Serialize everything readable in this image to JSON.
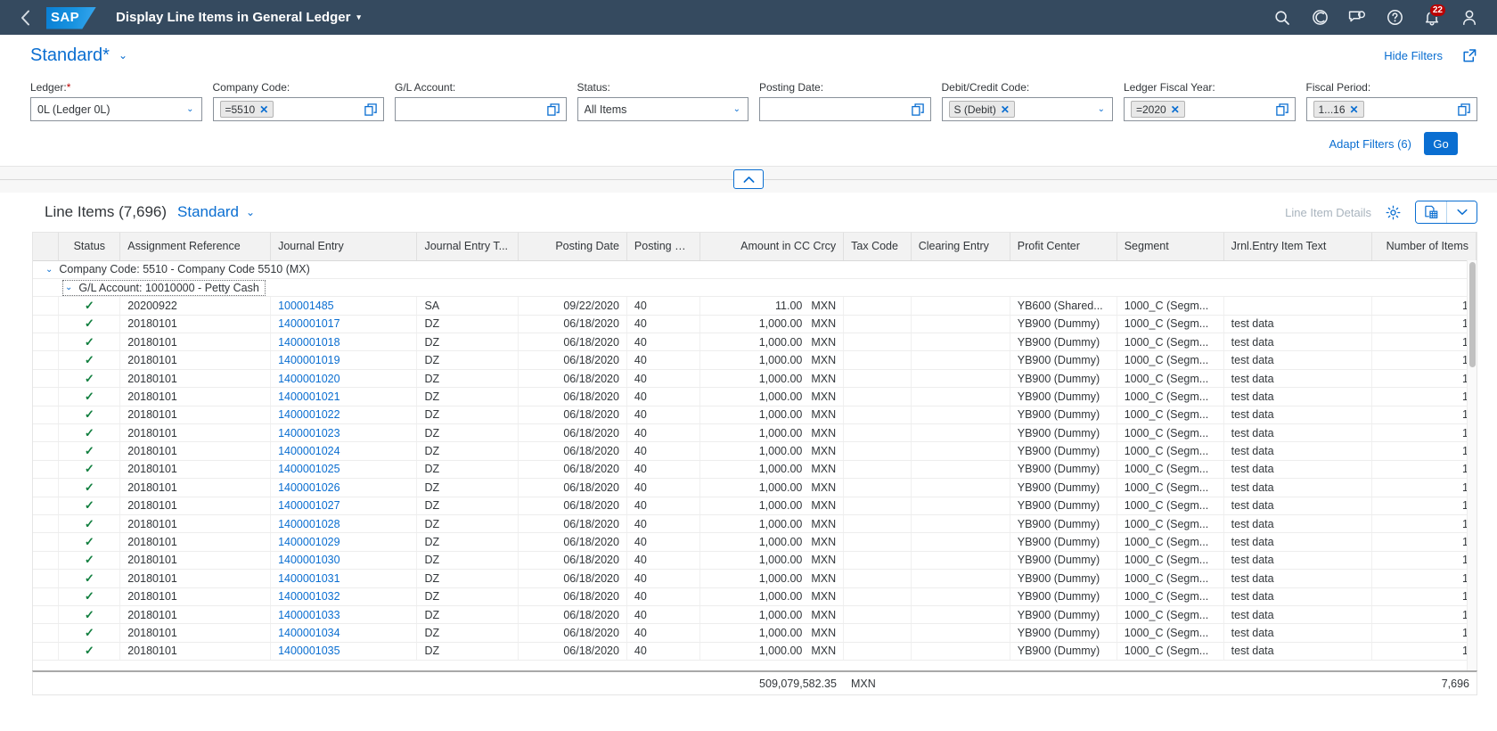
{
  "shell": {
    "back_icon": "navigate-back-icon",
    "logo_text": "SAP",
    "app_title": "Display Line Items in General Ledger",
    "title_caret": "▾",
    "icons": [
      {
        "name": "search-icon"
      },
      {
        "name": "copilot-icon"
      },
      {
        "name": "notes-icon"
      },
      {
        "name": "help-icon"
      },
      {
        "name": "notifications-icon",
        "badge": "22"
      },
      {
        "name": "user-avatar-icon"
      }
    ]
  },
  "variant": {
    "title": "Standard*",
    "caret": "⌄",
    "hide_filters": "Hide Filters",
    "share_icon": "share-icon"
  },
  "filters": [
    {
      "label": "Ledger:",
      "required": true,
      "type": "select",
      "value": "0L (Ledger 0L)",
      "placeholder": "",
      "name": "ledger"
    },
    {
      "label": "Company Code:",
      "required": false,
      "type": "token",
      "token": "=5510",
      "value": "",
      "placeholder": "",
      "name": "company-code"
    },
    {
      "label": "G/L Account:",
      "required": false,
      "type": "valuehelp",
      "value": "",
      "placeholder": "",
      "name": "gl-account"
    },
    {
      "label": "Status:",
      "required": false,
      "type": "select",
      "value": "All Items",
      "placeholder": "",
      "name": "status"
    },
    {
      "label": "Posting Date:",
      "required": false,
      "type": "valuehelp",
      "value": "",
      "placeholder": "",
      "name": "posting-date"
    },
    {
      "label": "Debit/Credit Code:",
      "required": false,
      "type": "token-select",
      "token": "S (Debit)",
      "value": "",
      "placeholder": "",
      "name": "debit-credit-code"
    },
    {
      "label": "Ledger Fiscal Year:",
      "required": false,
      "type": "token-valuehelp",
      "token": "=2020",
      "value": "",
      "placeholder": "",
      "name": "ledger-fiscal-year"
    },
    {
      "label": "Fiscal Period:",
      "required": false,
      "type": "token-valuehelp",
      "token": "1...16",
      "value": "",
      "placeholder": "",
      "name": "fiscal-period"
    }
  ],
  "filter_actions": {
    "adapt_filters": "Adapt Filters (6)",
    "go": "Go"
  },
  "table_toolbar": {
    "title": "Line Items (7,696)",
    "variant": "Standard",
    "variant_caret": "⌄",
    "line_item_details": "Line Item Details",
    "gear_icon": "settings-gear-icon",
    "export_icon": "export-to-spreadsheet-icon",
    "export_caret_icon": "chevron-down-icon"
  },
  "table": {
    "columns": [
      {
        "label": "Status",
        "align": "ctr"
      },
      {
        "label": "Assignment Reference",
        "align": "left"
      },
      {
        "label": "Journal Entry",
        "align": "left"
      },
      {
        "label": "Journal Entry T...",
        "align": "left"
      },
      {
        "label": "Posting Date",
        "align": "num"
      },
      {
        "label": "Posting Key",
        "align": "left"
      },
      {
        "label": "Amount in CC Crcy",
        "align": "num"
      },
      {
        "label": "Tax Code",
        "align": "left"
      },
      {
        "label": "Clearing Entry",
        "align": "left"
      },
      {
        "label": "Profit Center",
        "align": "left"
      },
      {
        "label": "Segment",
        "align": "left"
      },
      {
        "label": "Jrnl.Entry Item Text",
        "align": "left"
      },
      {
        "label": "Number of Items",
        "align": "num"
      }
    ],
    "groups": [
      {
        "level": 1,
        "label": "Company Code: 5510 - Company Code 5510 (MX)",
        "arrow": "⌄"
      },
      {
        "level": 2,
        "label": "G/L Account: 10010000 - Petty Cash",
        "arrow": "⌄",
        "focused": true
      }
    ],
    "status_check": "✓",
    "rows": [
      {
        "status": "✓",
        "assignment": "20200922",
        "journal_entry": "100001485",
        "jetype": "SA",
        "posting_date": "09/22/2020",
        "posting_key": "40",
        "amount": "11.00",
        "currency": "MXN",
        "tax_code": "",
        "clearing_entry": "",
        "profit_center": "YB600 (Shared...",
        "segment": "1000_C (Segm...",
        "item_text": "",
        "num_items": "1"
      },
      {
        "status": "✓",
        "assignment": "20180101",
        "journal_entry": "1400001017",
        "jetype": "DZ",
        "posting_date": "06/18/2020",
        "posting_key": "40",
        "amount": "1,000.00",
        "currency": "MXN",
        "tax_code": "",
        "clearing_entry": "",
        "profit_center": "YB900 (Dummy)",
        "segment": "1000_C (Segm...",
        "item_text": "test data",
        "num_items": "1"
      },
      {
        "status": "✓",
        "assignment": "20180101",
        "journal_entry": "1400001018",
        "jetype": "DZ",
        "posting_date": "06/18/2020",
        "posting_key": "40",
        "amount": "1,000.00",
        "currency": "MXN",
        "tax_code": "",
        "clearing_entry": "",
        "profit_center": "YB900 (Dummy)",
        "segment": "1000_C (Segm...",
        "item_text": "test data",
        "num_items": "1"
      },
      {
        "status": "✓",
        "assignment": "20180101",
        "journal_entry": "1400001019",
        "jetype": "DZ",
        "posting_date": "06/18/2020",
        "posting_key": "40",
        "amount": "1,000.00",
        "currency": "MXN",
        "tax_code": "",
        "clearing_entry": "",
        "profit_center": "YB900 (Dummy)",
        "segment": "1000_C (Segm...",
        "item_text": "test data",
        "num_items": "1"
      },
      {
        "status": "✓",
        "assignment": "20180101",
        "journal_entry": "1400001020",
        "jetype": "DZ",
        "posting_date": "06/18/2020",
        "posting_key": "40",
        "amount": "1,000.00",
        "currency": "MXN",
        "tax_code": "",
        "clearing_entry": "",
        "profit_center": "YB900 (Dummy)",
        "segment": "1000_C (Segm...",
        "item_text": "test data",
        "num_items": "1"
      },
      {
        "status": "✓",
        "assignment": "20180101",
        "journal_entry": "1400001021",
        "jetype": "DZ",
        "posting_date": "06/18/2020",
        "posting_key": "40",
        "amount": "1,000.00",
        "currency": "MXN",
        "tax_code": "",
        "clearing_entry": "",
        "profit_center": "YB900 (Dummy)",
        "segment": "1000_C (Segm...",
        "item_text": "test data",
        "num_items": "1"
      },
      {
        "status": "✓",
        "assignment": "20180101",
        "journal_entry": "1400001022",
        "jetype": "DZ",
        "posting_date": "06/18/2020",
        "posting_key": "40",
        "amount": "1,000.00",
        "currency": "MXN",
        "tax_code": "",
        "clearing_entry": "",
        "profit_center": "YB900 (Dummy)",
        "segment": "1000_C (Segm...",
        "item_text": "test data",
        "num_items": "1"
      },
      {
        "status": "✓",
        "assignment": "20180101",
        "journal_entry": "1400001023",
        "jetype": "DZ",
        "posting_date": "06/18/2020",
        "posting_key": "40",
        "amount": "1,000.00",
        "currency": "MXN",
        "tax_code": "",
        "clearing_entry": "",
        "profit_center": "YB900 (Dummy)",
        "segment": "1000_C (Segm...",
        "item_text": "test data",
        "num_items": "1"
      },
      {
        "status": "✓",
        "assignment": "20180101",
        "journal_entry": "1400001024",
        "jetype": "DZ",
        "posting_date": "06/18/2020",
        "posting_key": "40",
        "amount": "1,000.00",
        "currency": "MXN",
        "tax_code": "",
        "clearing_entry": "",
        "profit_center": "YB900 (Dummy)",
        "segment": "1000_C (Segm...",
        "item_text": "test data",
        "num_items": "1"
      },
      {
        "status": "✓",
        "assignment": "20180101",
        "journal_entry": "1400001025",
        "jetype": "DZ",
        "posting_date": "06/18/2020",
        "posting_key": "40",
        "amount": "1,000.00",
        "currency": "MXN",
        "tax_code": "",
        "clearing_entry": "",
        "profit_center": "YB900 (Dummy)",
        "segment": "1000_C (Segm...",
        "item_text": "test data",
        "num_items": "1"
      },
      {
        "status": "✓",
        "assignment": "20180101",
        "journal_entry": "1400001026",
        "jetype": "DZ",
        "posting_date": "06/18/2020",
        "posting_key": "40",
        "amount": "1,000.00",
        "currency": "MXN",
        "tax_code": "",
        "clearing_entry": "",
        "profit_center": "YB900 (Dummy)",
        "segment": "1000_C (Segm...",
        "item_text": "test data",
        "num_items": "1"
      },
      {
        "status": "✓",
        "assignment": "20180101",
        "journal_entry": "1400001027",
        "jetype": "DZ",
        "posting_date": "06/18/2020",
        "posting_key": "40",
        "amount": "1,000.00",
        "currency": "MXN",
        "tax_code": "",
        "clearing_entry": "",
        "profit_center": "YB900 (Dummy)",
        "segment": "1000_C (Segm...",
        "item_text": "test data",
        "num_items": "1"
      },
      {
        "status": "✓",
        "assignment": "20180101",
        "journal_entry": "1400001028",
        "jetype": "DZ",
        "posting_date": "06/18/2020",
        "posting_key": "40",
        "amount": "1,000.00",
        "currency": "MXN",
        "tax_code": "",
        "clearing_entry": "",
        "profit_center": "YB900 (Dummy)",
        "segment": "1000_C (Segm...",
        "item_text": "test data",
        "num_items": "1"
      },
      {
        "status": "✓",
        "assignment": "20180101",
        "journal_entry": "1400001029",
        "jetype": "DZ",
        "posting_date": "06/18/2020",
        "posting_key": "40",
        "amount": "1,000.00",
        "currency": "MXN",
        "tax_code": "",
        "clearing_entry": "",
        "profit_center": "YB900 (Dummy)",
        "segment": "1000_C (Segm...",
        "item_text": "test data",
        "num_items": "1"
      },
      {
        "status": "✓",
        "assignment": "20180101",
        "journal_entry": "1400001030",
        "jetype": "DZ",
        "posting_date": "06/18/2020",
        "posting_key": "40",
        "amount": "1,000.00",
        "currency": "MXN",
        "tax_code": "",
        "clearing_entry": "",
        "profit_center": "YB900 (Dummy)",
        "segment": "1000_C (Segm...",
        "item_text": "test data",
        "num_items": "1"
      },
      {
        "status": "✓",
        "assignment": "20180101",
        "journal_entry": "1400001031",
        "jetype": "DZ",
        "posting_date": "06/18/2020",
        "posting_key": "40",
        "amount": "1,000.00",
        "currency": "MXN",
        "tax_code": "",
        "clearing_entry": "",
        "profit_center": "YB900 (Dummy)",
        "segment": "1000_C (Segm...",
        "item_text": "test data",
        "num_items": "1"
      },
      {
        "status": "✓",
        "assignment": "20180101",
        "journal_entry": "1400001032",
        "jetype": "DZ",
        "posting_date": "06/18/2020",
        "posting_key": "40",
        "amount": "1,000.00",
        "currency": "MXN",
        "tax_code": "",
        "clearing_entry": "",
        "profit_center": "YB900 (Dummy)",
        "segment": "1000_C (Segm...",
        "item_text": "test data",
        "num_items": "1"
      },
      {
        "status": "✓",
        "assignment": "20180101",
        "journal_entry": "1400001033",
        "jetype": "DZ",
        "posting_date": "06/18/2020",
        "posting_key": "40",
        "amount": "1,000.00",
        "currency": "MXN",
        "tax_code": "",
        "clearing_entry": "",
        "profit_center": "YB900 (Dummy)",
        "segment": "1000_C (Segm...",
        "item_text": "test data",
        "num_items": "1"
      },
      {
        "status": "✓",
        "assignment": "20180101",
        "journal_entry": "1400001034",
        "jetype": "DZ",
        "posting_date": "06/18/2020",
        "posting_key": "40",
        "amount": "1,000.00",
        "currency": "MXN",
        "tax_code": "",
        "clearing_entry": "",
        "profit_center": "YB900 (Dummy)",
        "segment": "1000_C (Segm...",
        "item_text": "test data",
        "num_items": "1"
      },
      {
        "status": "✓",
        "assignment": "20180101",
        "journal_entry": "1400001035",
        "jetype": "DZ",
        "posting_date": "06/18/2020",
        "posting_key": "40",
        "amount": "1,000.00",
        "currency": "MXN",
        "tax_code": "",
        "clearing_entry": "",
        "profit_center": "YB900 (Dummy)",
        "segment": "1000_C (Segm...",
        "item_text": "test data",
        "num_items": "1"
      }
    ],
    "total": {
      "amount": "509,079,582.35",
      "currency": "MXN",
      "num_items": "7,696"
    }
  },
  "colors": {
    "shell_bg": "#354a5f",
    "accent": "#0a6ed1",
    "success": "#107e3e",
    "error": "#bb0000"
  }
}
